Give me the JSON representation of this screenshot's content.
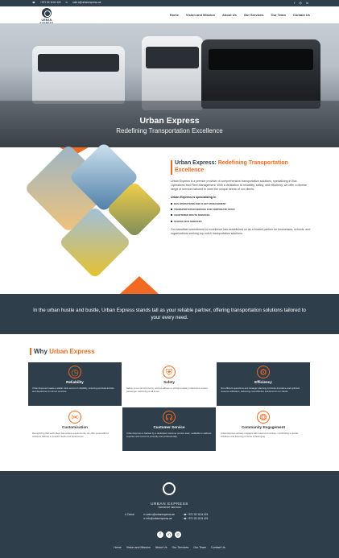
{
  "topbar": {
    "phone": "+971 52 1104 424",
    "email": "sale.s@urbanexpress.ae",
    "social_icons": [
      "facebook-icon",
      "instagram-icon",
      "linkedin-icon"
    ]
  },
  "nav": {
    "logo_text": "URBAN EXPRESS",
    "items": [
      "Home",
      "Vision and Mission",
      "About Us",
      "Our Services",
      "Our Team",
      "Contact Us"
    ]
  },
  "hero": {
    "title": "Urban Express",
    "subtitle": "Redefining Transportation Excellence"
  },
  "about": {
    "title_main": "Urban Express: ",
    "title_accent": "Redefining Transportation Excellence",
    "intro": "Urban Express is a premier provider of comprehensive transportation solutions, specializing in Bus Operations and Fleet Management. With a dedication to reliability, safety, and efficiency, we offer a diverse range of services tailored to meet the unique needs of our clients.",
    "specializing_label": "Urban Express is specializing in",
    "services": [
      "BUS OPERATIONS AND FLEET MANAGEMENT",
      "TRANSPORTATION SERVICE FOR CORPORATE STAFF",
      "CHARTERED ROUTE SERVICES",
      "SCHOOL BUS SERVICES"
    ],
    "closing": "Our steadfast commitment to excellence has established us as a trusted partner for businesses, schools, and organizations seeking top-notch transportation solutions."
  },
  "banner": {
    "text": "In the urban hustle and bustle, Urban Express stands tall as your reliable partner, offering transportation solutions tailored to your every need."
  },
  "why": {
    "title_main": "Why ",
    "title_accent": "Urban Express",
    "cards": [
      {
        "title": "Reliability",
        "icon": "clock-icon",
        "text": "Urban Express boasts a stellar track record of reliability, ensuring punctual arrivals and departures for all our services."
      },
      {
        "title": "Safety",
        "icon": "shield-hand-icon",
        "text": "Safety is our utmost priority, and we adhere to stringent safety protocols to ensure passenger well-being at all times."
      },
      {
        "title": "Efficiency",
        "icon": "gear-chart-icon",
        "text": "Our efficient operations and strategic planning minimize downtime and optimize resource utilization, delivering cost-effective solutions for our clients."
      },
      {
        "title": "Customisation",
        "icon": "tools-icon",
        "text": "Recognizing that each client has unique requirements, we offer personalized solutions tailored to specific needs and preferences."
      },
      {
        "title": "Customer Service",
        "icon": "headset-icon",
        "text": "Urban Express is backed by a dedicated customer service team, available to address inquiries and concerns promptly and professionally."
      },
      {
        "title": "Community Engagement",
        "icon": "people-network-icon",
        "text": "Urban Express actively engages with local communities, contributing to social initiatives and fostering a sense of belonging."
      }
    ]
  },
  "footer": {
    "logo_text": "URBAN EXPRESS",
    "tagline": "TRANSPORT SERVICES",
    "location": "Dubai",
    "emails": [
      "sale.s@urbanexpress.ae",
      "info@urbanexpress.ae"
    ],
    "phones": [
      "+971 52 1104 424",
      "+971 52 1104 424"
    ],
    "social_icons": [
      "facebook-icon",
      "linkedin-icon",
      "instagram-icon"
    ],
    "links": [
      "Home",
      "Vision and Mission",
      "About Us",
      "Our Services",
      "Our Team",
      "Contact Us"
    ]
  },
  "colors": {
    "primary": "#2f3e4b",
    "accent": "#f26a21"
  }
}
